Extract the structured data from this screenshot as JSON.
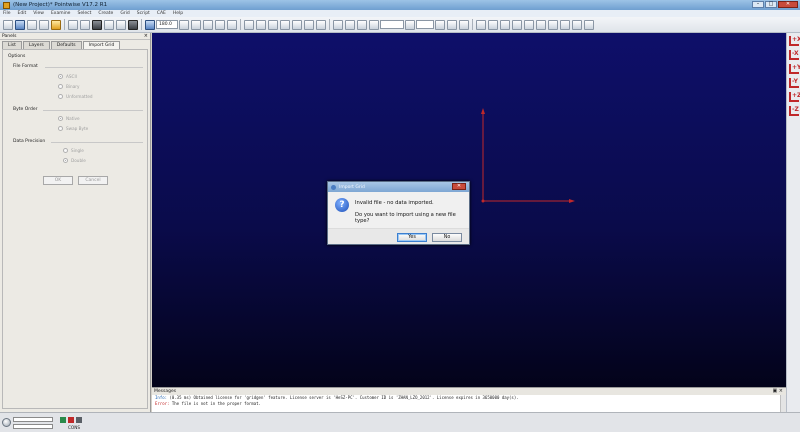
{
  "window": {
    "title": "(New Project)* Pointwise V17.2 R1",
    "controls": {
      "minimize": "–",
      "maximize": "□",
      "close": "✕"
    }
  },
  "menu": [
    "File",
    "Edit",
    "View",
    "Examine",
    "Select",
    "Create",
    "Grid",
    "Script",
    "CAE",
    "Help"
  ],
  "toolbar": {
    "zoom_value": "180.0",
    "icons": [
      "open-icon",
      "save-icon",
      "undo-icon",
      "redo-icon",
      "script-icon",
      "shapes-icon",
      "point-icon",
      "curve-icon",
      "view-icon",
      "transform-icon",
      "grid-icon",
      "solver-icon",
      "mask-icon"
    ]
  },
  "panels": {
    "title": "Panels",
    "close": "×",
    "tabs": [
      "List",
      "Layers",
      "Defaults",
      "Import Grid"
    ],
    "active_tab": "Import Grid",
    "options_label": "Options",
    "file_format": {
      "label": "File Format",
      "options": [
        "ASCII",
        "Binary",
        "Unformatted"
      ],
      "selected": "ASCII"
    },
    "byte_order": {
      "label": "Byte Order",
      "options": [
        "Native",
        "Swap Byte"
      ],
      "selected": "Native"
    },
    "data_precision": {
      "label": "Data Precision",
      "options": [
        "Single",
        "Double"
      ],
      "selected": "Double"
    },
    "ok_label": "OK",
    "cancel_label": "Cancel"
  },
  "axis_tools": [
    "+X",
    "-X",
    "+Y",
    "-Y",
    "+Z",
    "-Z"
  ],
  "dialog": {
    "title": "Import Grid",
    "close": "✕",
    "message_line1": "Invalid file - no data imported.",
    "message_line2": "Do you want to import using a new file type?",
    "yes_label": "Yes",
    "no_label": "No"
  },
  "messages": {
    "title": "Messages",
    "controls": "▣ ×",
    "lines": [
      {
        "tag": "Info:",
        "text": " (0.35 ms) Obtained license for 'gridgen' feature. License server is 'HeSZ-PC'. Customer ID is 'ZHAN_LZO_2012'. License expires in 3650000 day(s)."
      },
      {
        "tag": "Error:",
        "text": " The file is not in the proper format."
      }
    ]
  },
  "status": {
    "label": "CONS"
  },
  "colors": {
    "canvas_top": "#0e0f6a",
    "canvas_bottom": "#03031a",
    "axis": "#c0282a",
    "error": "#c02020",
    "info": "#1b5fb0"
  }
}
